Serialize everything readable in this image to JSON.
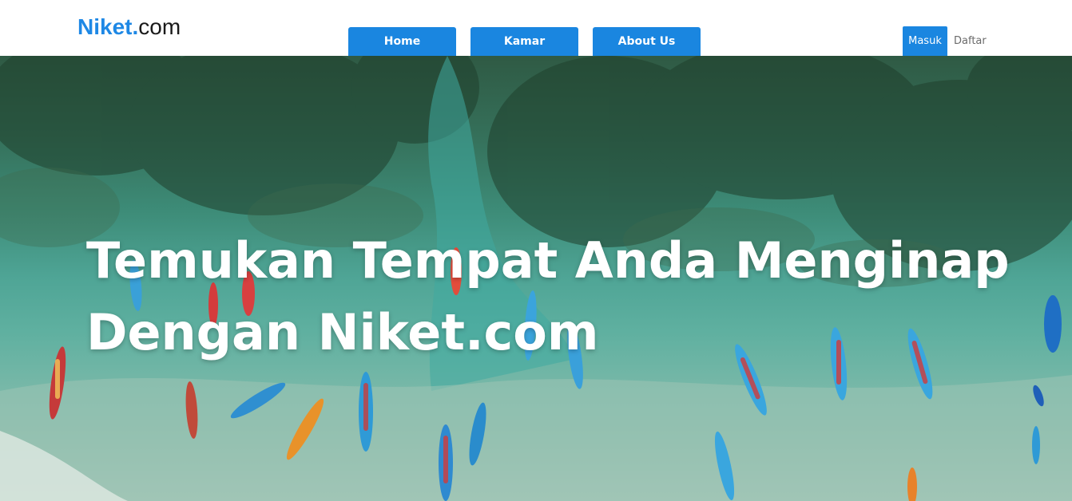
{
  "logo": {
    "brand": "Niket",
    "dot": ".",
    "tld": "com"
  },
  "nav": {
    "items": [
      {
        "label": "Home"
      },
      {
        "label": "Kamar"
      },
      {
        "label": "About Us"
      }
    ]
  },
  "auth": {
    "login_label": "Masuk",
    "register_label": "Daftar"
  },
  "hero": {
    "title_line1": "Temukan Tempat Anda Menginap",
    "title_line2": "Dengan Niket.com",
    "image": "aerial-beach-boats"
  },
  "colors": {
    "accent": "#1a86e0",
    "brand": "#1e88e5"
  }
}
